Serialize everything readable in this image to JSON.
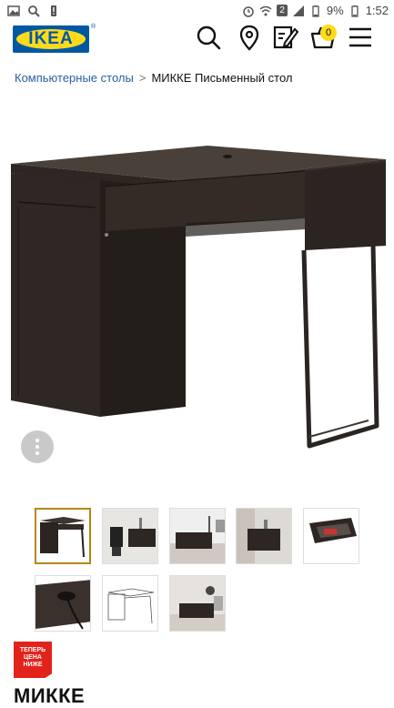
{
  "status_bar": {
    "battery_pct": "9%",
    "time": "1:52",
    "notif_count": "2"
  },
  "header": {
    "logo_text": "IKEA",
    "logo_mark": "®",
    "cart_count": "0",
    "icons": [
      "search-icon",
      "location-pin-icon",
      "list-edit-icon",
      "cart-icon",
      "menu-icon"
    ]
  },
  "breadcrumb": {
    "parent": "Компьютерные столы",
    "separator": ">",
    "current": "МИККЕ Письменный стол"
  },
  "gallery": {
    "thumbnails": [
      {
        "label": "desk-front",
        "selected": true
      },
      {
        "label": "desk-with-chair",
        "selected": false
      },
      {
        "label": "desk-in-room",
        "selected": false
      },
      {
        "label": "desk-side-room",
        "selected": false
      },
      {
        "label": "drawer-open",
        "selected": false
      },
      {
        "label": "cable-hole",
        "selected": false
      },
      {
        "label": "desk-drawing",
        "selected": false
      },
      {
        "label": "desk-room-light",
        "selected": false
      }
    ]
  },
  "badge": {
    "line1": "ТЕПЕРЬ",
    "line2": "ЦЕНА",
    "line3": "НИЖЕ"
  },
  "product": {
    "title": "МИККЕ"
  },
  "colors": {
    "ikea_blue": "#0058a3",
    "ikea_yellow": "#ffda1a",
    "badge_red": "#e2231a",
    "desk": "#3a302b"
  }
}
